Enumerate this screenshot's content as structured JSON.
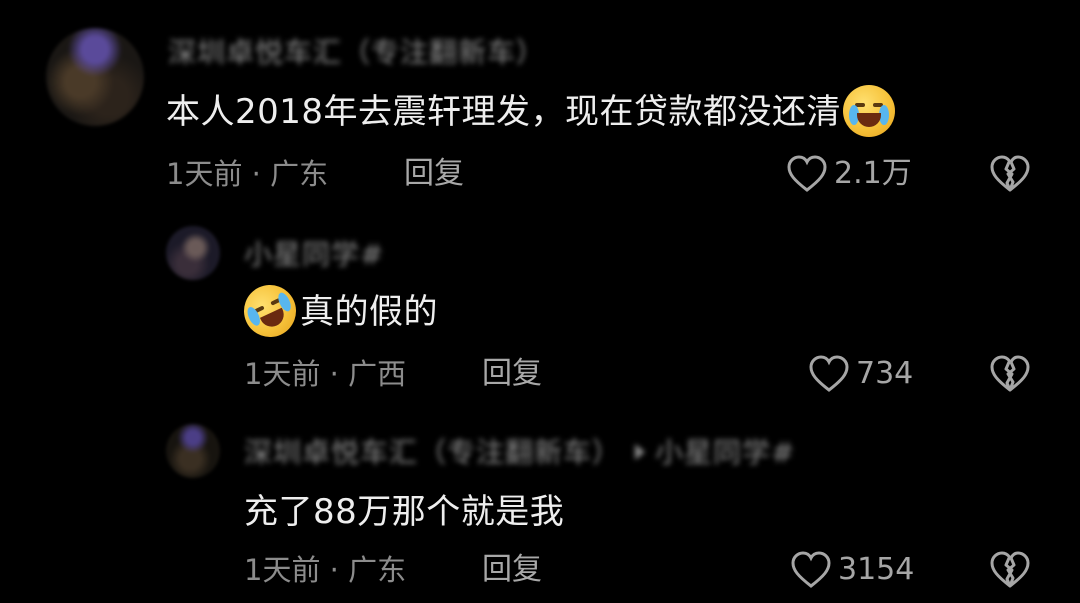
{
  "comments": [
    {
      "username": "深圳卓悦车汇（专注翻新车）",
      "text": "本人2018年去震轩理发，现在贷款都没还清",
      "emoji": "loudly-crying-face",
      "time": "1天前",
      "location": "广东",
      "reply_label": "回复",
      "likes": "2.1万"
    },
    {
      "username": "小星同学#",
      "text": "真的假的",
      "emoji": "rolling-on-floor-laughing-face",
      "time": "1天前",
      "location": "广西",
      "reply_label": "回复",
      "likes": "734"
    },
    {
      "username": "深圳卓悦车汇（专注翻新车）",
      "reply_to": "小星同学#",
      "text": "充了88万那个就是我",
      "time": "1天前",
      "location": "广东",
      "reply_label": "回复",
      "likes": "3154"
    }
  ],
  "separator": "·",
  "colors": {
    "background": "#000000",
    "text": "#eeeeee",
    "meta": "#8c8c8c",
    "icon": "#a6a6a6",
    "tear": "#58b6ee",
    "emoji_face": "#f6c23a"
  }
}
